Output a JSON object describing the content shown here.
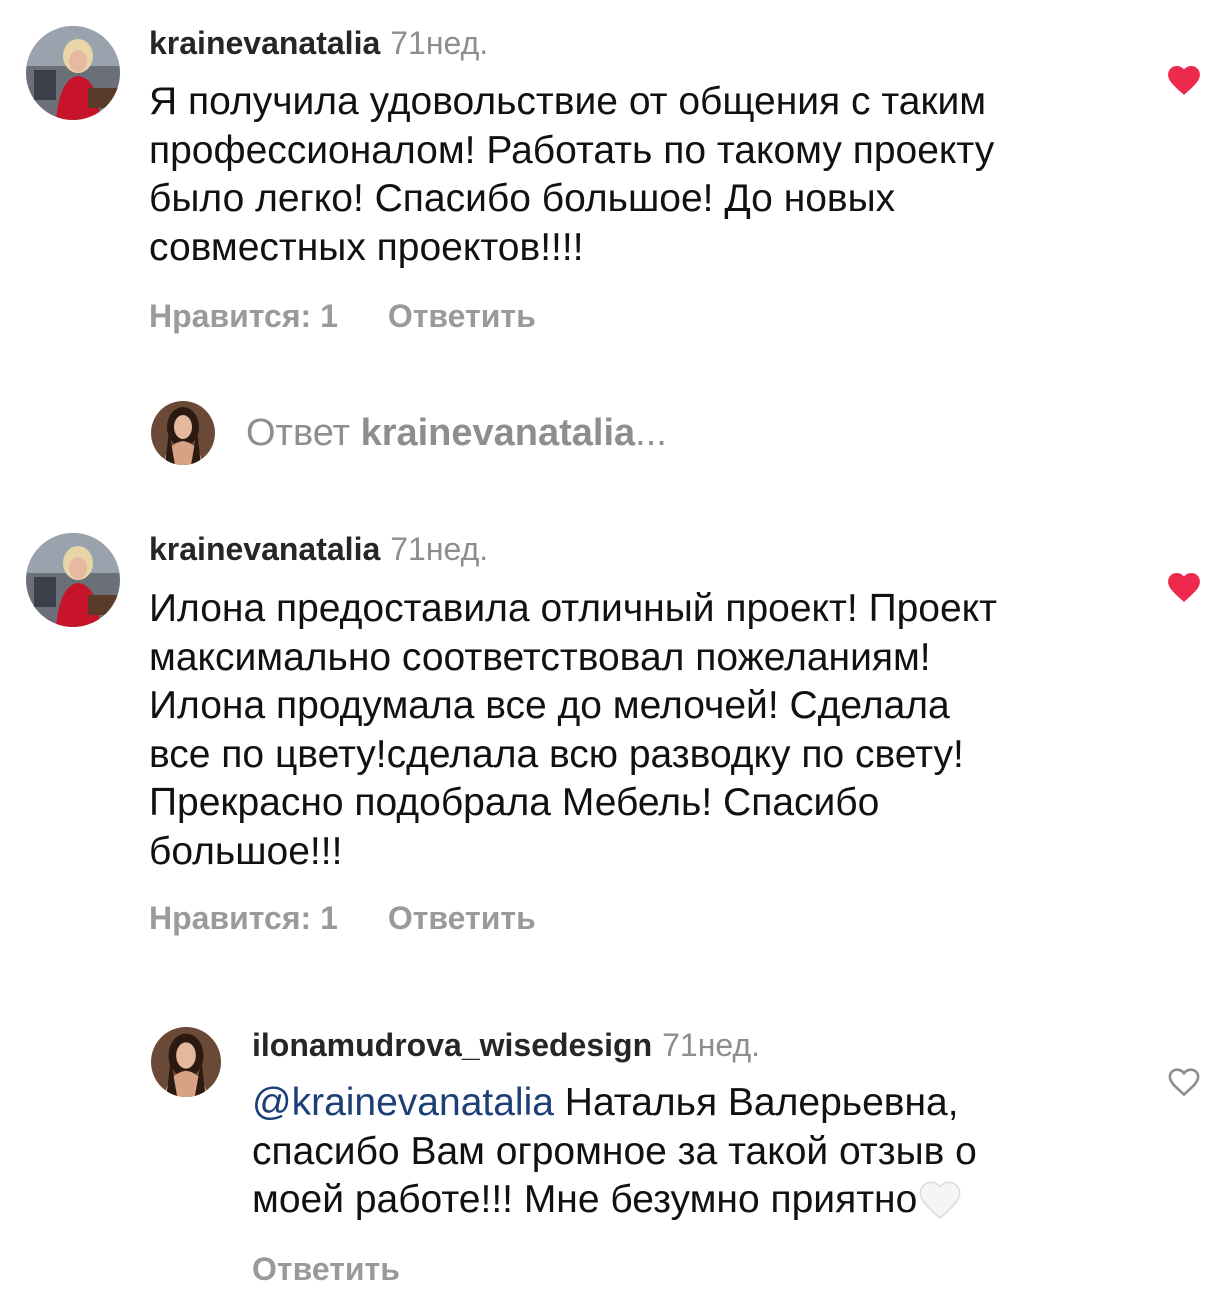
{
  "comments": [
    {
      "username": "krainevanatalia",
      "time": "71нед.",
      "text": "Я получила удовольствие от общения с таким\nпрофессионалом! Работать по такому проекту\nбыло легко! Спасибо большое! До новых\nсовместных проектов!!!!",
      "likes_label": "Нравится: 1",
      "reply_label": "Ответить",
      "liked": true,
      "like_color": "#ed2a4e"
    },
    {
      "username": "krainevanatalia",
      "time": "71нед.",
      "text": "Илона предоставила отличный проект! Проект\nмаксимально соответствовал пожеланиям!\nИлона продумала все до мелочей! Сделала\nвсе по цвету!сделала всю разводку по свету!\nПрекрасно подобрала Мебель! Спасибо\nбольшое!!!",
      "likes_label": "Нравится: 1",
      "reply_label": "Ответить",
      "liked": true,
      "like_color": "#ed2a4e"
    }
  ],
  "reply_thread_link": {
    "prefix": "Ответ ",
    "username": "krainevanatalia",
    "suffix": "..."
  },
  "reply": {
    "username": "ilonamudrova_wisedesign",
    "time": "71нед.",
    "mention": "@krainevanatalia",
    "text_line1": " Наталья Валерьевна,",
    "text_rest": "спасибо Вам огромное за такой отзыв о\nмоей работе!!! Мне безумно приятно",
    "reply_label": "Ответить",
    "liked": false,
    "emoji": "white-heart-emoji"
  },
  "icons": {
    "liked_heart": "heart-filled-icon",
    "unliked_heart": "heart-outline-icon"
  }
}
